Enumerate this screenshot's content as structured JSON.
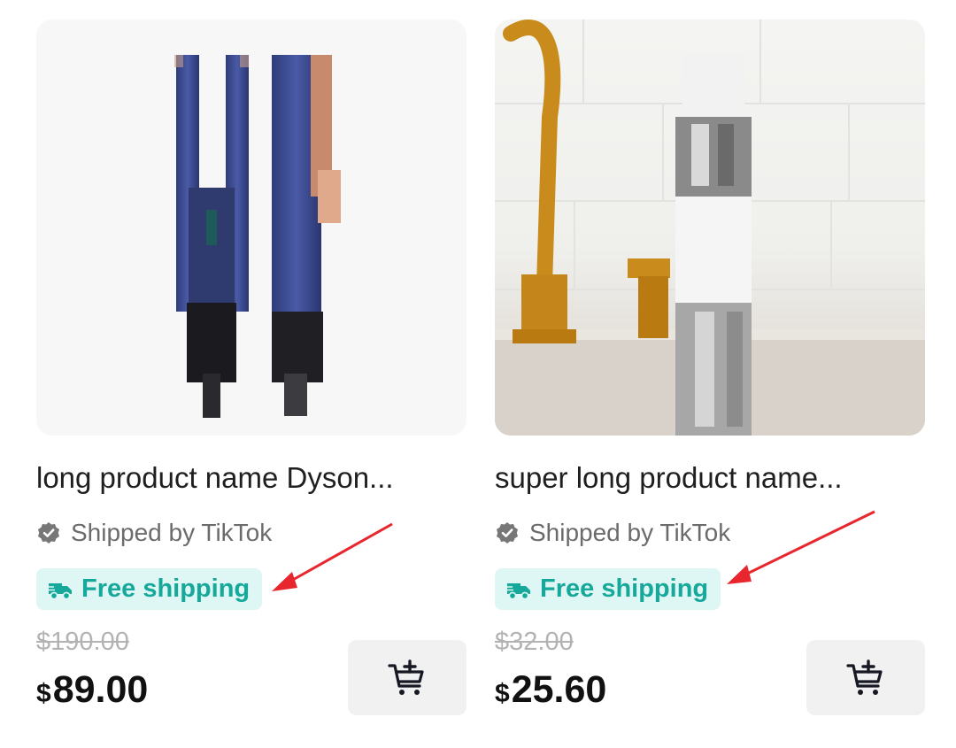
{
  "products": [
    {
      "name": "long product name Dyson...",
      "shipped_by": "Shipped by TikTok",
      "shipping_badge": "Free shipping",
      "original_price": "$190.00",
      "price_currency": "$",
      "price_amount": "89.00",
      "image": "pixelated-hair-straightener-image",
      "cart_icon": "add-to-cart-icon"
    },
    {
      "name": "super long product name...",
      "shipped_by": "Shipped by TikTok",
      "shipping_badge": "Free shipping",
      "original_price": "$32.00",
      "price_currency": "$",
      "price_amount": "25.60",
      "image": "pixelated-bottle-on-sink-image",
      "cart_icon": "add-to-cart-icon"
    }
  ],
  "colors": {
    "badge_background": "#dff7f4",
    "badge_text": "#15a89b",
    "annotation_arrow": "#e8262e",
    "strikethrough_price": "#b3b3b3"
  }
}
